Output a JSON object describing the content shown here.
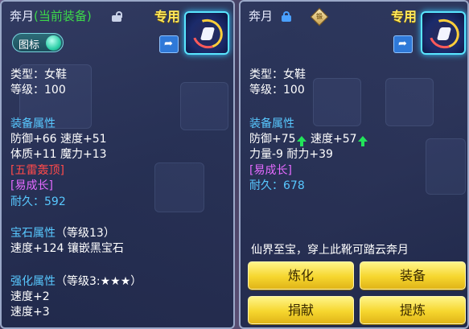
{
  "left": {
    "title_name": "奔月",
    "title_status": "(当前装备)",
    "zhuanyong": "专用",
    "toggle_label": "图标",
    "type": "类型：女鞋",
    "level": "等级：100",
    "equip_attr_heading": "装备属性",
    "attr_line1": "防御+66 速度+51",
    "attr_line2": "体质+11 魔力+13",
    "special1": "[五雷轰顶]",
    "special2": "[易成长]",
    "durability_label": "耐久：",
    "durability_value": "592",
    "gem_heading": "宝石属性",
    "gem_level": "（等级13）",
    "gem_line": "速度+124 镶嵌黑宝石",
    "strengthen_heading": "强化属性",
    "strengthen_level": "（等级3:★★★）",
    "strengthen_line1": "速度+2",
    "strengthen_line2": "速度+3"
  },
  "right": {
    "title_name": "奔月",
    "zhuanyong": "专用",
    "diamond_glyph": "锻",
    "type": "类型：女鞋",
    "level": "等级：100",
    "equip_attr_heading": "装备属性",
    "def": "防御+75",
    "spd": "速度+57",
    "attr_line2": "力量-9 耐力+39",
    "special1": "[易成长]",
    "durability_label": "耐久：",
    "durability_value": "678",
    "description": "仙界至宝，穿上此靴可踏云奔月",
    "buttons": [
      "炼化",
      "装备",
      "捐献",
      "提炼"
    ]
  },
  "colors": {
    "heading": "#58c8ff",
    "current_equipped": "#3dd94a",
    "special_red": "#ff4a4a",
    "special_magenta": "#e46aff",
    "button_yellow": "#f6d62e",
    "zhuanyong_yellow": "#ffe95a",
    "stat_up_green": "#22e35a"
  },
  "icons": [
    "lock-icon",
    "lock-blue-icon",
    "share-icon",
    "item-boots-icon",
    "forge-diamond-icon",
    "stat-up-arrow-icon"
  ]
}
